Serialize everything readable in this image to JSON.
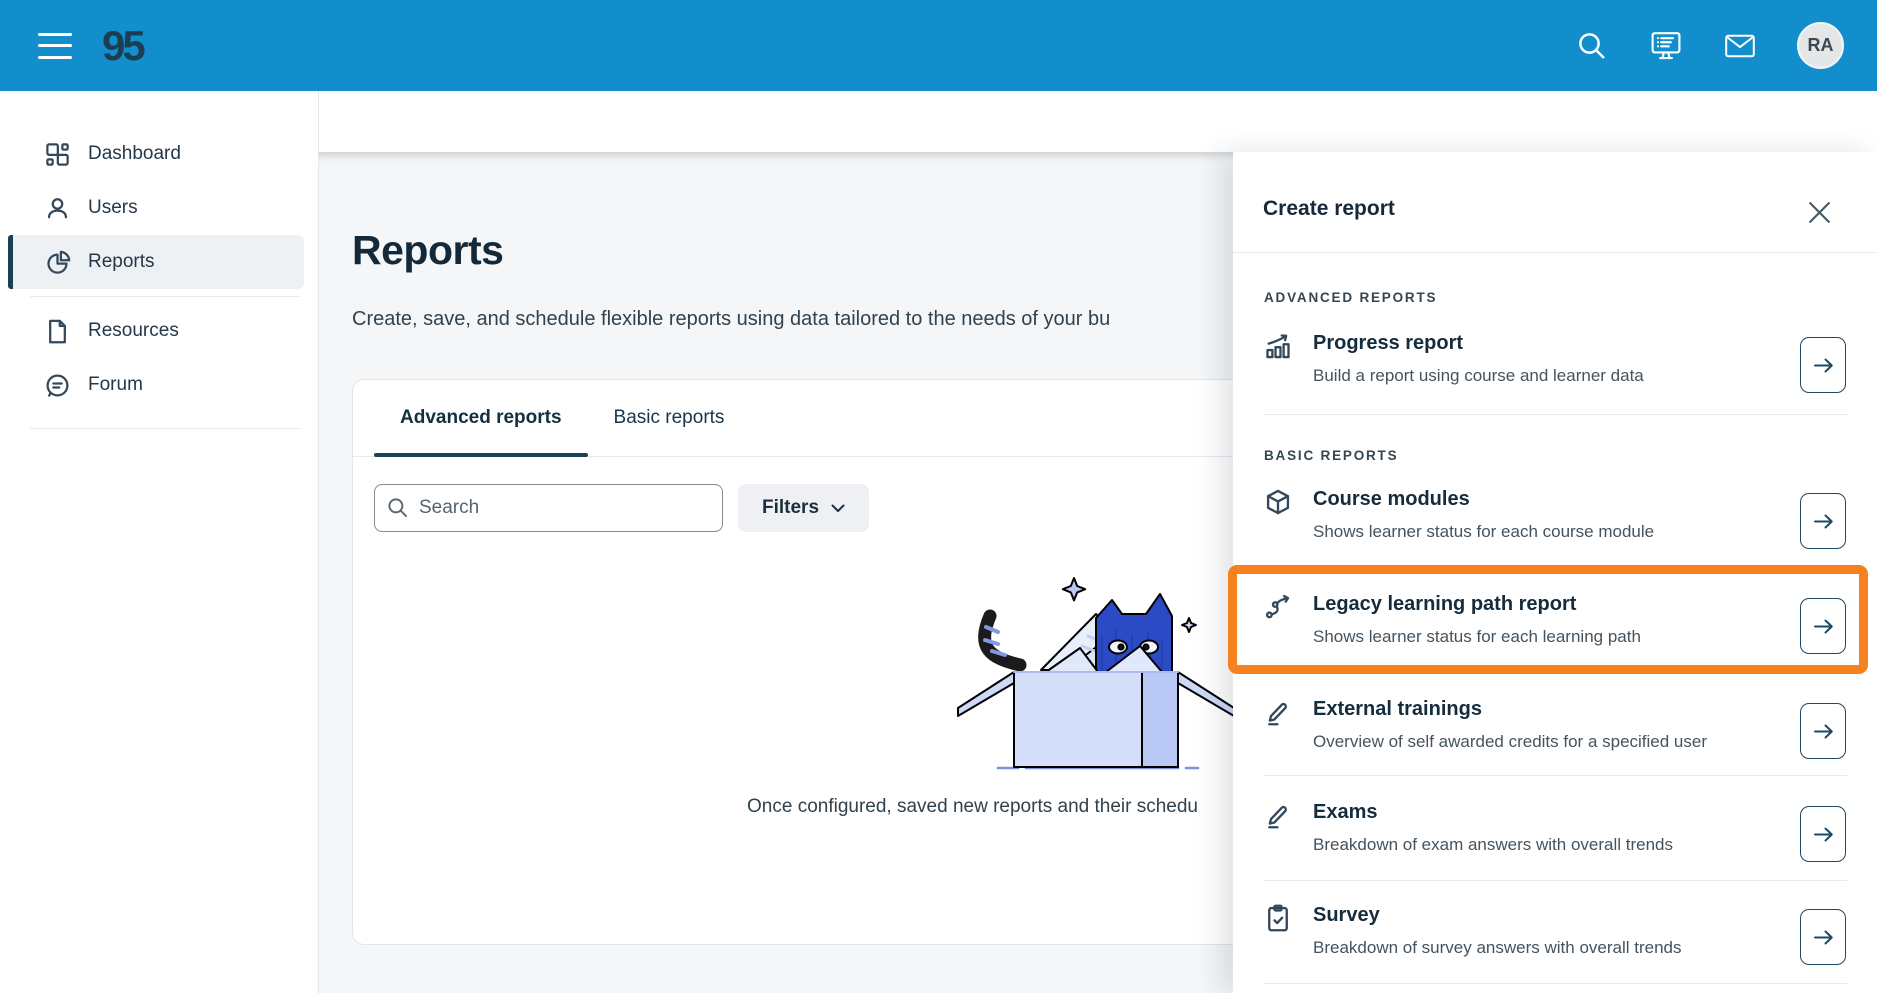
{
  "topbar": {
    "logo": "95",
    "icons": [
      "menu-icon",
      "search-icon",
      "presentation-icon",
      "mail-icon"
    ],
    "avatar_initials": "RA"
  },
  "sidebar": {
    "items": [
      {
        "label": "Dashboard",
        "icon": "dashboard-icon",
        "active": false
      },
      {
        "label": "Users",
        "icon": "user-icon",
        "active": false
      },
      {
        "label": "Reports",
        "icon": "pie-chart-icon",
        "active": true
      },
      {
        "label": "Resources",
        "icon": "document-icon",
        "active": false
      },
      {
        "label": "Forum",
        "icon": "speech-bubble-icon",
        "active": false
      }
    ]
  },
  "page": {
    "title": "Reports",
    "description": "Create, save, and schedule flexible reports using data tailored to the needs of your bu",
    "tabs": [
      {
        "label": "Advanced reports",
        "active": true
      },
      {
        "label": "Basic reports",
        "active": false
      }
    ],
    "search_placeholder": "Search",
    "filters_label": "Filters",
    "empty_caption": "Once configured, saved new reports and their schedu"
  },
  "panel": {
    "title": "Create report",
    "close_icon": "close-icon",
    "sections": [
      {
        "label": "ADVANCED REPORTS",
        "items": [
          {
            "title": "Progress report",
            "desc": "Build a report using course and learner data",
            "icon": "bar-chart-arrow-icon",
            "highlighted": false
          }
        ]
      },
      {
        "label": "BASIC REPORTS",
        "items": [
          {
            "title": "Course modules",
            "desc": "Shows learner status for each course module",
            "icon": "cube-icon",
            "highlighted": false
          },
          {
            "title": "Legacy learning path report",
            "desc": "Shows learner status for each learning path",
            "icon": "path-nodes-icon",
            "highlighted": true
          },
          {
            "title": "External trainings",
            "desc": "Overview of self awarded credits for a specified user",
            "icon": "pencil-icon",
            "highlighted": false
          },
          {
            "title": "Exams",
            "desc": "Breakdown of exam answers with overall trends",
            "icon": "pencil-icon",
            "highlighted": false
          },
          {
            "title": "Survey",
            "desc": "Breakdown of survey answers with overall trends",
            "icon": "clipboard-check-icon",
            "highlighted": false
          }
        ]
      }
    ]
  },
  "colors": {
    "topbar_blue": "#118ECB",
    "navy": "#1B3F54",
    "annotation_orange": "#F5821F",
    "content_bg": "#F4F6F8"
  }
}
